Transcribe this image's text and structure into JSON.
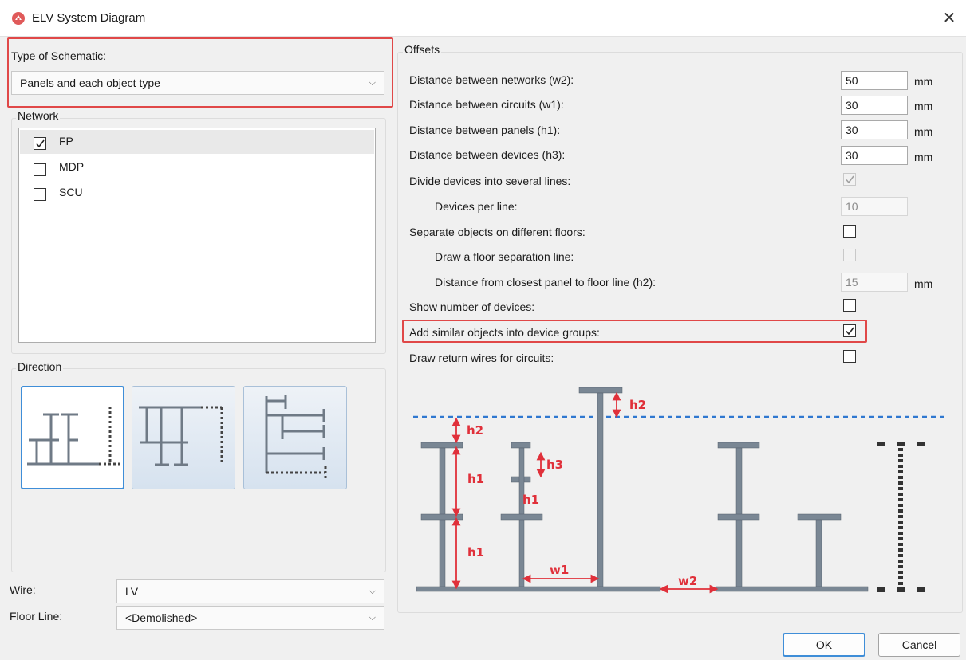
{
  "window": {
    "title": "ELV System Diagram",
    "close_glyph": "✕"
  },
  "schematic": {
    "label": "Type of Schematic:",
    "value": "Panels and each object type"
  },
  "network": {
    "title": "Network",
    "items": [
      {
        "label": "FP",
        "checked": true
      },
      {
        "label": "MDP",
        "checked": false
      },
      {
        "label": "SCU",
        "checked": false
      }
    ]
  },
  "direction": {
    "title": "Direction"
  },
  "wire": {
    "label": "Wire:",
    "value": "LV"
  },
  "floor_line": {
    "label": "Floor Line:",
    "value": "<Demolished>"
  },
  "offsets": {
    "title": "Offsets",
    "unit": "mm",
    "rows": [
      {
        "label": "Distance between networks (w2):",
        "value": "50"
      },
      {
        "label": "Distance between circuits (w1):",
        "value": "30"
      },
      {
        "label": "Distance between panels (h1):",
        "value": "30"
      },
      {
        "label": "Distance between devices (h3):",
        "value": "30"
      },
      {
        "label": "Divide devices into several lines:"
      },
      {
        "label": "Devices per line:",
        "value": "10"
      },
      {
        "label": "Separate objects on different floors:"
      },
      {
        "label": "Draw a floor separation line:"
      },
      {
        "label": "Distance from closest panel to floor line (h2):",
        "value": "15"
      },
      {
        "label": "Show number of devices:"
      },
      {
        "label": "Add similar objects into device groups:"
      },
      {
        "label": "Draw return wires for circuits:"
      }
    ]
  },
  "diagram_labels": {
    "h2": "h2",
    "h1": "h1",
    "h3": "h3",
    "w1": "w1",
    "w2": "w2"
  },
  "buttons": {
    "ok": "OK",
    "cancel": "Cancel"
  },
  "colors": {
    "accent": "#3f8ed8",
    "highlight": "#e04848",
    "dimension": "#e0303a",
    "floor_line": "#2f78d0",
    "bar": "#7a8794"
  }
}
